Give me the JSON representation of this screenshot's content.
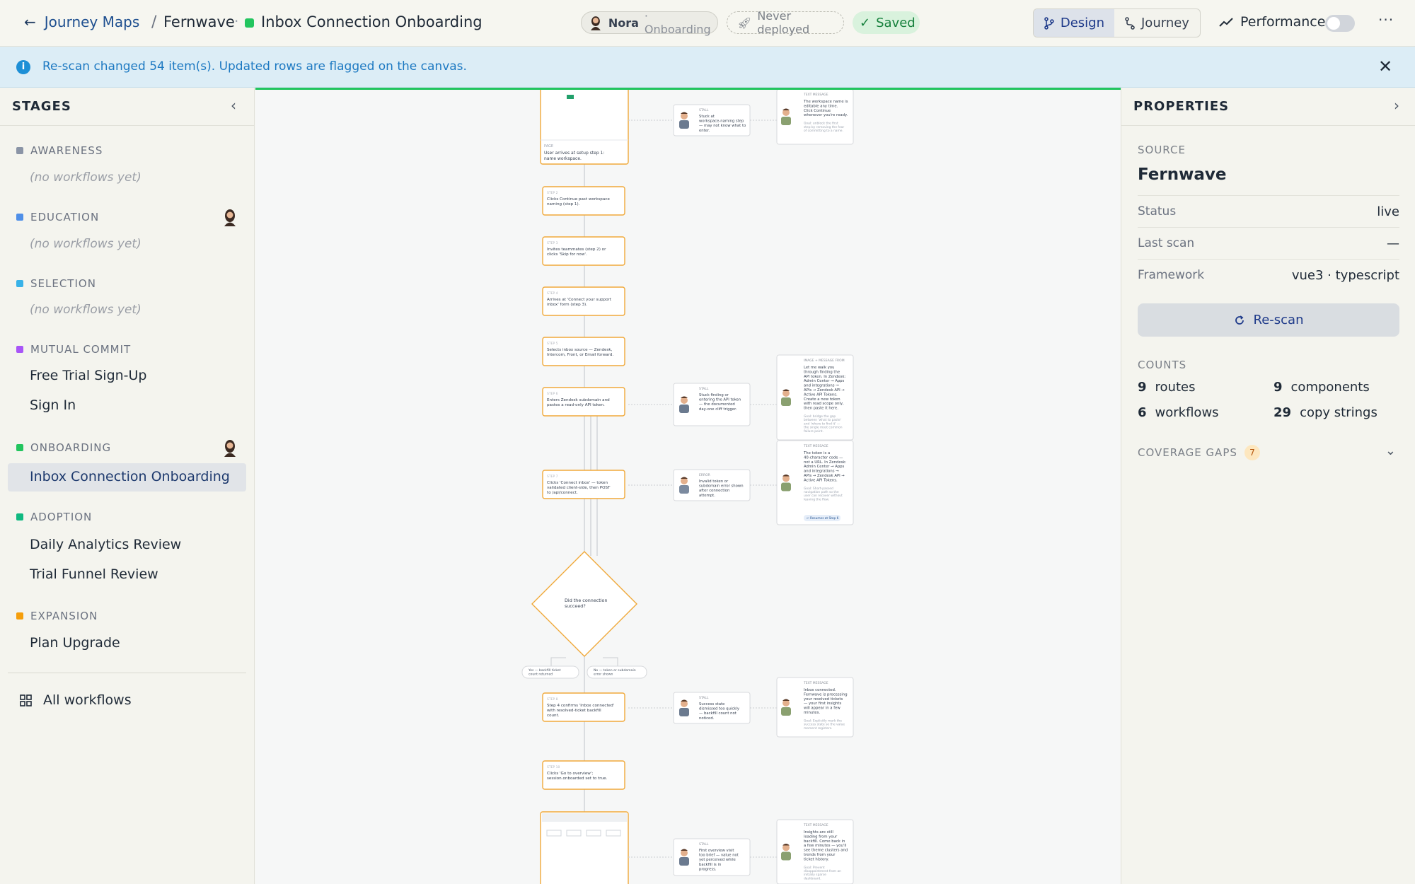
{
  "topbar": {
    "back_label": "Journey Maps",
    "crumb_sep": "/",
    "project": "Fernwave",
    "crumb_dot": "·",
    "flow_name": "Inbox Connection Onboarding",
    "user_name": "Nora",
    "user_role": "· Onboarding",
    "deploy_status": "Never deployed",
    "save_status": "Saved",
    "mode_design": "Design",
    "mode_journey": "Journey",
    "performance_label": "Performance",
    "more_label": "···"
  },
  "banner": {
    "message": "Re-scan changed 54 item(s). Updated rows are flagged on the canvas.",
    "info_glyph": "i",
    "close_glyph": "✕"
  },
  "sidebar": {
    "title": "STAGES",
    "collapse_glyph": "‹",
    "stages": [
      {
        "name": "AWARENESS",
        "color": "#8a94a6",
        "empty": "(no workflows yet)"
      },
      {
        "name": "EDUCATION",
        "color": "#4f8fe8",
        "empty": "(no workflows yet)"
      },
      {
        "name": "SELECTION",
        "color": "#38b2e8",
        "empty": "(no workflows yet)"
      },
      {
        "name": "MUTUAL COMMIT",
        "color": "#a855f7",
        "workflows": [
          "Free Trial Sign-Up",
          "Sign In"
        ]
      },
      {
        "name": "ONBOARDING",
        "color": "#22c55e",
        "workflows": [
          "Inbox Connection Onboarding"
        ]
      },
      {
        "name": "ADOPTION",
        "color": "#10b981",
        "workflows": [
          "Daily Analytics Review",
          "Trial Funnel Review"
        ]
      },
      {
        "name": "EXPANSION",
        "color": "#f59e0b",
        "workflows": [
          "Plan Upgrade"
        ]
      }
    ],
    "all_workflows": "All workflows"
  },
  "canvas": {
    "colors": {
      "step_border": "#f0a93a",
      "line": "#c9ccd0",
      "card_border": "#d7d9dc",
      "accent": "#22c55e"
    },
    "step_labels": [
      "STEP 2",
      "STEP 3",
      "STEP 4",
      "STEP 5",
      "STEP 6",
      "STEP 7",
      "STEP 8",
      "STEP 10"
    ],
    "page_label": "PAGE",
    "page1_text": "User arrives at setup step 1: name workspace.",
    "steps": [
      {
        "label": "STEP 2",
        "text": "Clicks Continue past workspace naming (step 1)."
      },
      {
        "label": "STEP 3",
        "text": "Invites teammates (step 2) or clicks 'Skip for now'."
      },
      {
        "label": "STEP 4",
        "text": "Arrives at 'Connect your support inbox' form (step 3)."
      },
      {
        "label": "STEP 5",
        "text": "Selects inbox source — Zendesk, Intercom, Front, or Email forward."
      },
      {
        "label": "STEP 6",
        "text": "Enters Zendesk subdomain and pastes a read-only API token."
      },
      {
        "label": "STEP 7",
        "text": "Clicks 'Connect inbox' — token validated client-side, then POST to /api/connect."
      },
      {
        "label": "STEP 8",
        "text": "Step 4 confirms 'Inbox connected' with resolved-ticket backfill count."
      },
      {
        "label": "STEP 10",
        "text": "Clicks 'Go to overview'; session.onboarded set to true."
      }
    ],
    "decision": "Did the connection succeed?",
    "branch_yes": "Yes — backfill ticket count returned",
    "branch_no": "No — token or subdomain error shown",
    "pains": [
      {
        "label": "STALL",
        "text": "Stuck at workspace-naming step — may not know what to enter."
      },
      {
        "label": "STALL",
        "text": "Stuck finding or entering the API token — the documented day-one cliff trigger."
      },
      {
        "label": "ERROR",
        "text": "Invalid token or subdomain error shown after connection attempt."
      },
      {
        "label": "STALL",
        "text": "Success state dismissed too quickly — backfill count not noticed."
      },
      {
        "label": "STALL",
        "text": "First overview visit too brief — value not yet perceived while backfill is in progress."
      }
    ],
    "messages": [
      {
        "label": "TEXT MESSAGE",
        "text": "The workspace name is editable any time. Click Continue whenever you're ready.",
        "goal": "Goal: unblock the first step by removing the fear of committing to a name."
      },
      {
        "label": "IMAGE + MESSAGE FROM",
        "text": "Let me walk you through finding the API token. In Zendesk: Admin Center → Apps and integrations → APIs → Zendesk API → Active API Tokens. Create a new token with read scope only, then paste it here.",
        "goal": "Goal: bridge the gap between 'what to paste' and 'where to find it' — the single most common failure point."
      },
      {
        "label": "TEXT MESSAGE",
        "text": "The token is a 40-character code — not a URL. In Zendesk: Admin Center → Apps and integrations → APIs → Zendesk API → Active API Tokens.",
        "goal": "Goal: Short-passed navigation path so the user can recover without leaving the flow.",
        "chip": "↩ Resumes at Step 6"
      },
      {
        "label": "TEXT MESSAGE",
        "text": "Inbox connected. Fernwave is processing your resolved tickets — your first insights will appear in a few minutes.",
        "goal": "Goal: Explicitly mark the success state so the value moment registers."
      },
      {
        "label": "TEXT MESSAGE",
        "text": "Insights are still loading from your backfill. Come back in a few minutes — you'll see theme clusters and trends from your ticket history.",
        "goal": "Goal: Prevent disappointment from an initially sparse dashboard."
      }
    ]
  },
  "properties": {
    "title": "PROPERTIES",
    "expand_glyph": "›",
    "source_label": "SOURCE",
    "source": "Fernwave",
    "rows": [
      {
        "key": "Status",
        "value": "live"
      },
      {
        "key": "Last scan",
        "value": "—"
      },
      {
        "key": "Framework",
        "value": "vue3 · typescript"
      }
    ],
    "rescan_label": "Re-scan",
    "counts_label": "COUNTS",
    "counts": [
      {
        "n": "9",
        "label": "routes"
      },
      {
        "n": "9",
        "label": "components"
      },
      {
        "n": "6",
        "label": "workflows"
      },
      {
        "n": "29",
        "label": "copy strings"
      }
    ],
    "gaps_label": "COVERAGE GAPS",
    "gaps_count": "7"
  }
}
